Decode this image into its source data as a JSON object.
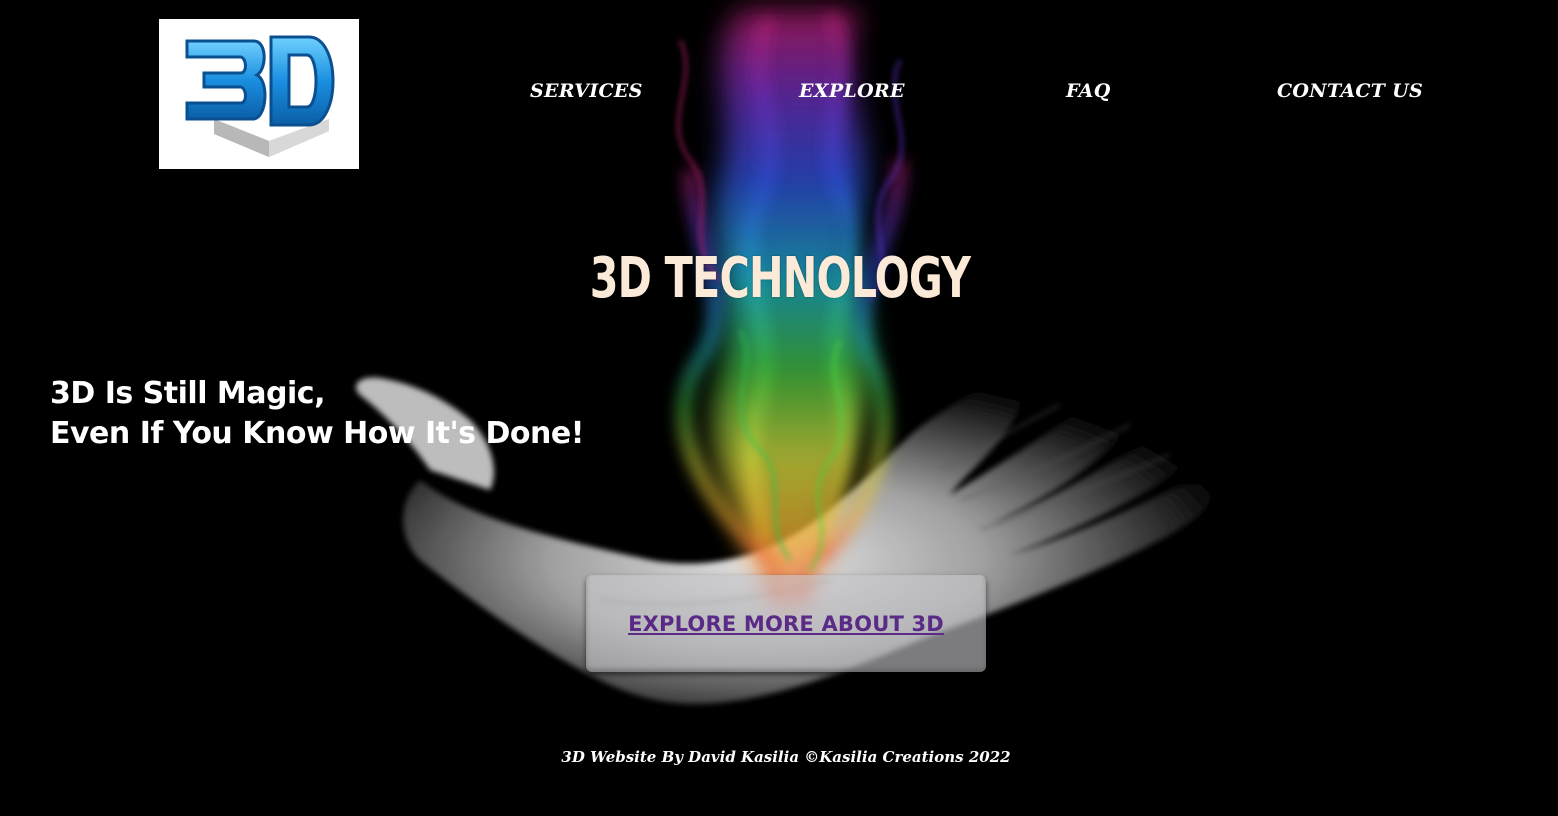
{
  "logo": {
    "text": "3D",
    "icon": "3d-cube-logo-icon"
  },
  "nav": {
    "services": "SERVICES",
    "explore": "EXPLORE",
    "faq": "FAQ",
    "contact": "CONTACT US"
  },
  "hero": {
    "title": "3D TECHNOLOGY",
    "tagline_line1": "3D Is Still Magic,",
    "tagline_line2": "Even If You Know How It's Done!",
    "background_icon": "hand-with-rainbow-smoke-image"
  },
  "cta": {
    "label": "EXPLORE MORE ABOUT 3D"
  },
  "footer": {
    "text": "3D Website By David Kasilia ©Kasilia Creations 2022"
  },
  "colors": {
    "background": "#000000",
    "title": "#fbead8",
    "cta_text": "#5a2a86",
    "nav_text": "#ffffff"
  }
}
